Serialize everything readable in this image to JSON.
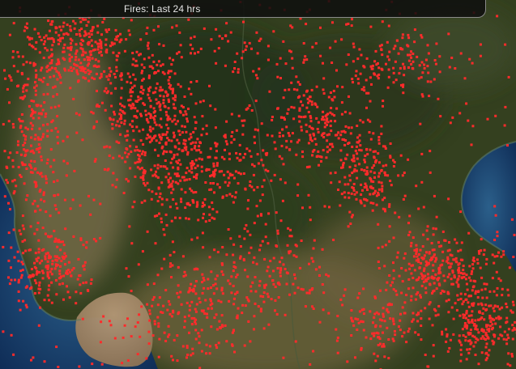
{
  "layer": {
    "title": "Fires: Last 24 hrs"
  },
  "colors": {
    "fire_point": "#ff2b2b",
    "land_dark": "#2f3d22",
    "land_light": "#7b6f4e",
    "sea_deep": "#0f2d57",
    "sea_shallow": "#2b5f8a",
    "sediment": "#a88a66"
  }
}
